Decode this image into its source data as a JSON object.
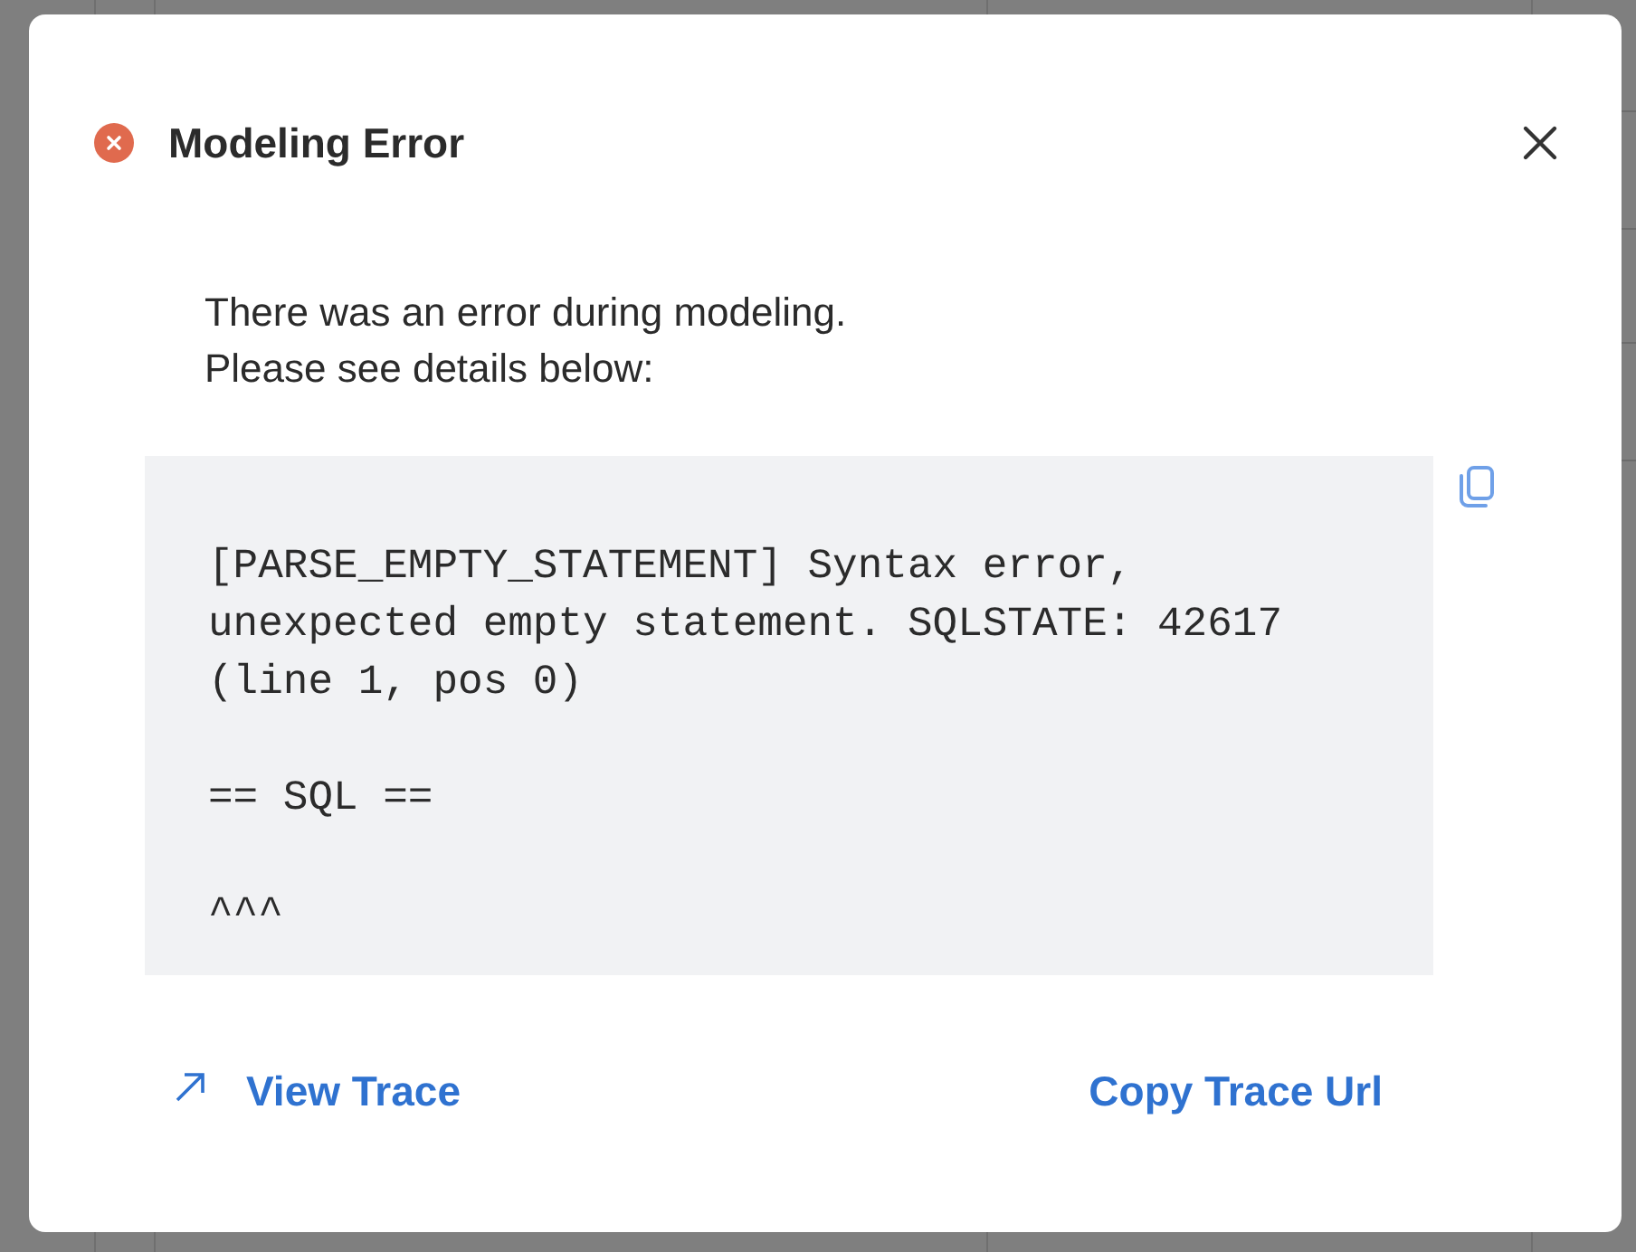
{
  "dialog": {
    "title": "Modeling Error",
    "kind": "error",
    "message": [
      "There was an error during modeling.",
      "Please see details below:"
    ],
    "details": "[PARSE_EMPTY_STATEMENT] Syntax error,\nunexpected empty statement. SQLSTATE: 42617\n(line 1, pos 0)\n\n== SQL ==\n\n^^^",
    "links": [
      {
        "label": "View Trace",
        "kind": "external"
      },
      {
        "label": "Copy Trace Url",
        "kind": "plain"
      }
    ]
  }
}
